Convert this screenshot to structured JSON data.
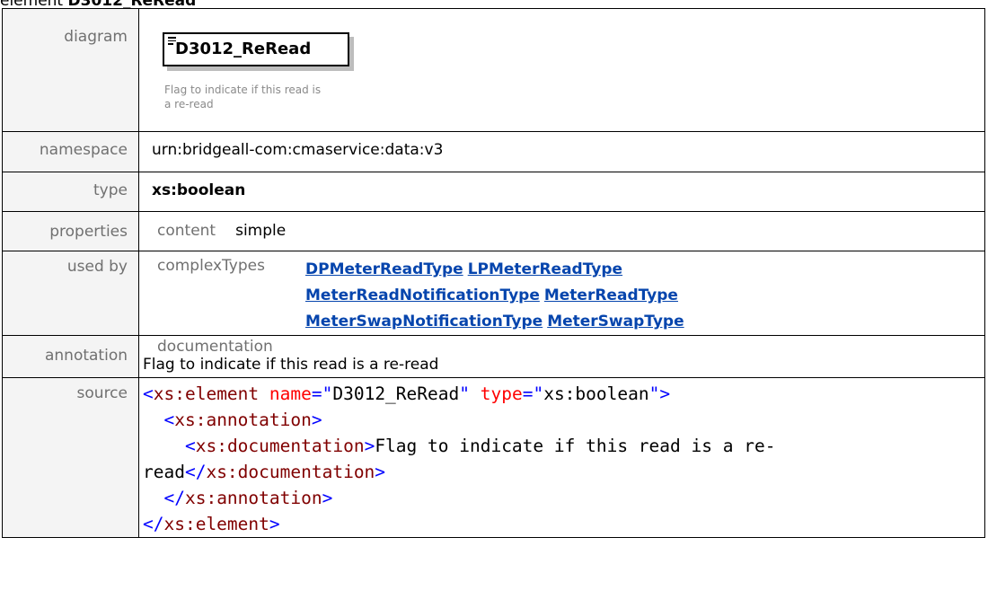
{
  "heading": {
    "prefix": "element",
    "name": "D3012_ReRead"
  },
  "labels": {
    "diagram": "diagram",
    "namespace": "namespace",
    "type": "type",
    "properties": "properties",
    "used_by": "used by",
    "annotation": "annotation",
    "source": "source"
  },
  "diagram": {
    "element_name": "D3012_ReRead",
    "doc_text": "Flag to indicate if this read is a re-read"
  },
  "namespace": "urn:bridgeall-com:cmaservice:data:v3",
  "type": "xs:boolean",
  "properties": {
    "key": "content",
    "value": "simple"
  },
  "used_by": {
    "key": "complexTypes",
    "links": [
      "DPMeterReadType",
      "LPMeterReadType",
      "MeterReadNotificationType",
      "MeterReadType",
      "MeterSwapNotificationType",
      "MeterSwapType"
    ]
  },
  "annotation": {
    "key": "documentation",
    "text": "Flag to indicate if this read is a re-read"
  },
  "source": {
    "element_tag": "xs:element",
    "name_attr": "name",
    "name_val": "D3012_ReRead",
    "type_attr": "type",
    "type_val": "xs:boolean",
    "annotation_tag": "xs:annotation",
    "documentation_tag": "xs:documentation",
    "doc_line1": "Flag to indicate if this read is a re-",
    "doc_line2": "read"
  },
  "colors": {
    "link": "#0645ad",
    "xml_tag": "#800000",
    "xml_bracket": "#0000ff",
    "xml_attr": "#ff0000",
    "label_bg": "#f4f4f4"
  }
}
